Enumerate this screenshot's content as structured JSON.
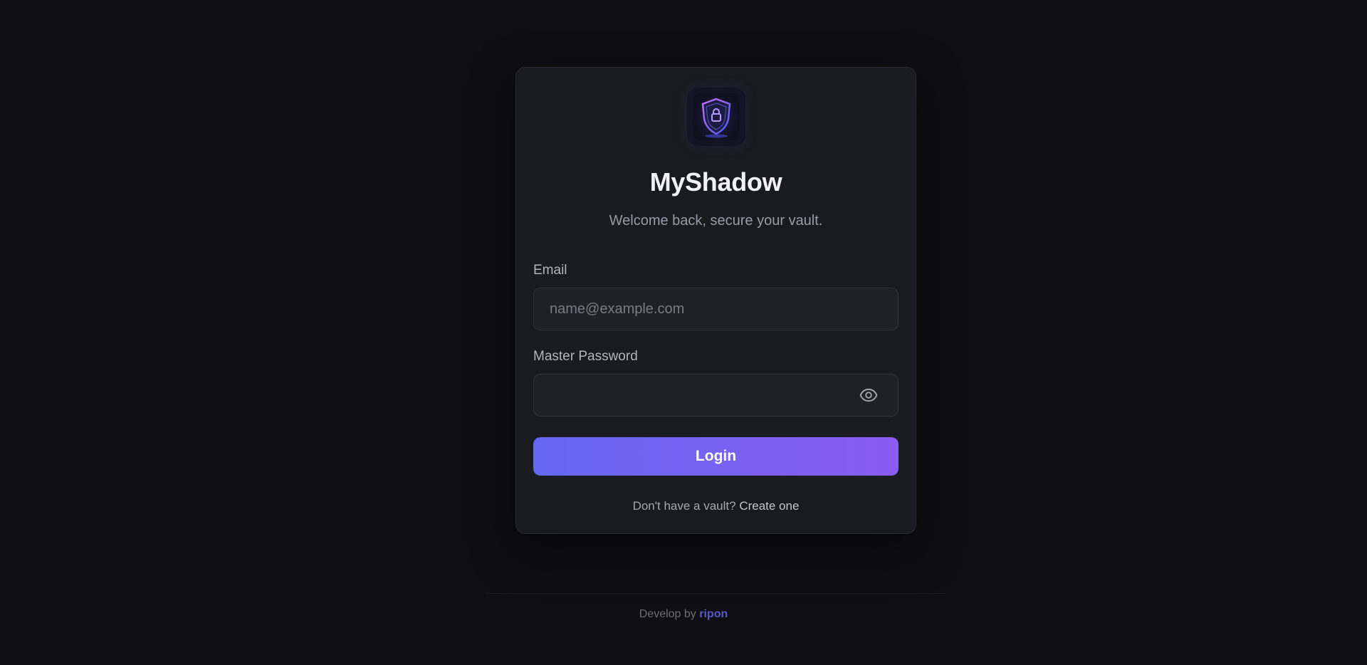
{
  "app": {
    "title": "MyShadow",
    "subtitle": "Welcome back, secure your vault."
  },
  "form": {
    "email_label": "Email",
    "email_placeholder": "name@example.com",
    "email_value": "",
    "password_label": "Master Password",
    "password_value": "",
    "toggle_icon": "eye-icon",
    "login_label": "Login"
  },
  "signup": {
    "prompt": "Don't have a vault?",
    "link": "Create one"
  },
  "footer": {
    "prefix": "Develop by",
    "author": "ripon"
  },
  "colors": {
    "background": "#0f0f13",
    "card": "#1a1b20",
    "accent_start": "#6467f2",
    "accent_end": "#8a5cf4",
    "footer_link": "#5b56c9"
  }
}
